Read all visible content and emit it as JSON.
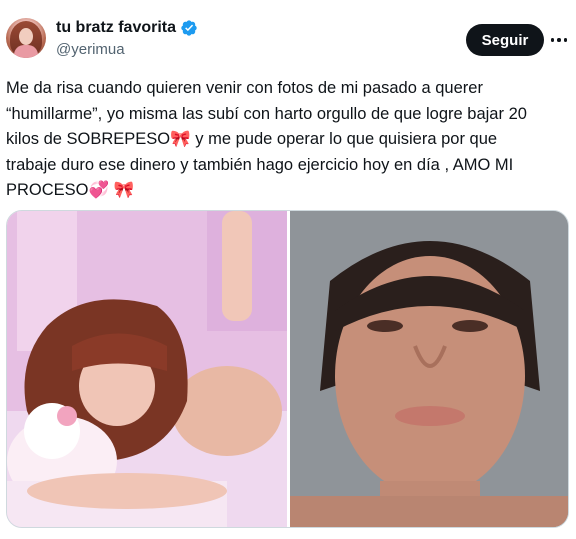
{
  "user": {
    "display_name": "tu bratz favorita",
    "handle": "@yerimua",
    "verified": true
  },
  "actions": {
    "follow_label": "Seguir",
    "more_icon": "more-horizontal-icon"
  },
  "tweet": {
    "lines": [
      "Me da risa cuando quieren venir con fotos de mi pasado a querer",
      "“humillarme”, yo misma las subí con harto orgullo de que logre bajar 20",
      "kilos de SOBREPESO🎀 y me pude operar lo que quisiera por que",
      "trabaje duro ese dinero y también hago ejercicio hoy en día , AMO MI",
      "PROCESO💞 🎀"
    ]
  },
  "media": {
    "count": 2,
    "images": [
      "photo-left",
      "photo-right"
    ]
  },
  "colors": {
    "text": "#0f1419",
    "secondary": "#536471",
    "verified": "#1d9bf0",
    "button_bg": "#0f1419",
    "border": "#cfd9de"
  }
}
